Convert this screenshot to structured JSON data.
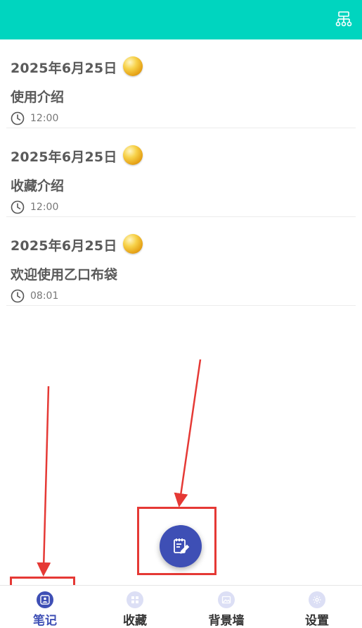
{
  "topbar": {
    "menu_icon": "sitemap-icon",
    "color": "#00D5BF"
  },
  "notes": [
    {
      "date": "2025年6月25日",
      "title": "使用介绍",
      "time": "12:00"
    },
    {
      "date": "2025年6月25日",
      "title": "收藏介绍",
      "time": "12:00"
    },
    {
      "date": "2025年6月25日",
      "title": "欢迎使用乙口布袋",
      "time": "08:01"
    }
  ],
  "fab": {
    "icon": "edit-note-icon",
    "color": "#3E4FB5"
  },
  "bottom_nav": {
    "tabs": [
      {
        "label": "笔记",
        "icon": "user-icon",
        "active": true
      },
      {
        "label": "收藏",
        "icon": "grid-icon",
        "active": false
      },
      {
        "label": "背景墙",
        "icon": "image-icon",
        "active": false
      },
      {
        "label": "设置",
        "icon": "gear-icon",
        "active": false
      }
    ]
  },
  "colors": {
    "accent": "#3E4FB5",
    "annotation": "#e53935"
  }
}
